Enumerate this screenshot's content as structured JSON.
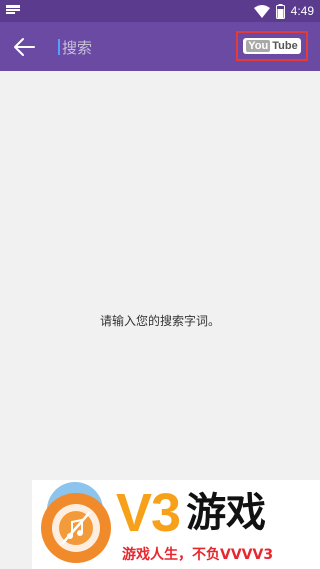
{
  "status_bar": {
    "time": "4:49",
    "icons": [
      "notification-icon",
      "wifi-icon",
      "battery-icon"
    ]
  },
  "app_bar": {
    "back_icon": "arrow-left-icon",
    "search_placeholder": "搜索",
    "logo_you": "You",
    "logo_tube": "Tube"
  },
  "content": {
    "prompt": "请输入您的搜索字词。"
  },
  "banner": {
    "title_v3": "V3",
    "title_youxi": "游戏",
    "slogan": "游戏人生，不负VVVV3"
  },
  "colors": {
    "status_bar": "#5a3b8e",
    "app_bar": "#6a4aa3",
    "background": "#f1f1f1",
    "highlight_box": "#e23b3b",
    "banner_orange": "#f7a11a",
    "banner_red": "#e8262e"
  }
}
